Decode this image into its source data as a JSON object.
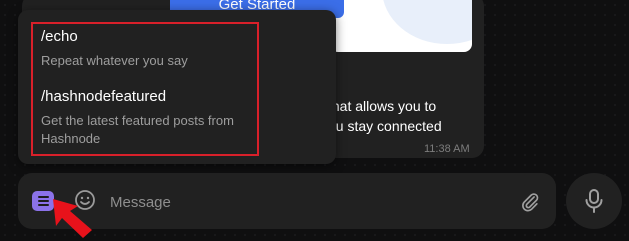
{
  "chat": {
    "cta_label": "Get Started",
    "message_line1": "that allows you to",
    "message_line2": "ou stay connected",
    "message_time": "11:38 AM"
  },
  "commands": [
    {
      "name": "/echo",
      "description": "Repeat whatever you say"
    },
    {
      "name": "/hashnodefeatured",
      "description": "Get the latest featured posts from Hashnode"
    }
  ],
  "composer": {
    "placeholder": "Message",
    "menu_icon": "menu-icon",
    "emoji_icon": "smiley-icon",
    "attach_icon": "paperclip-icon",
    "mic_icon": "microphone-icon"
  },
  "annotation": {
    "highlight_color": "#d9202a",
    "arrow_color": "#e8121b"
  },
  "colors": {
    "accent": "#8b72e8",
    "surface": "#212121",
    "background": "#0f0f10"
  }
}
